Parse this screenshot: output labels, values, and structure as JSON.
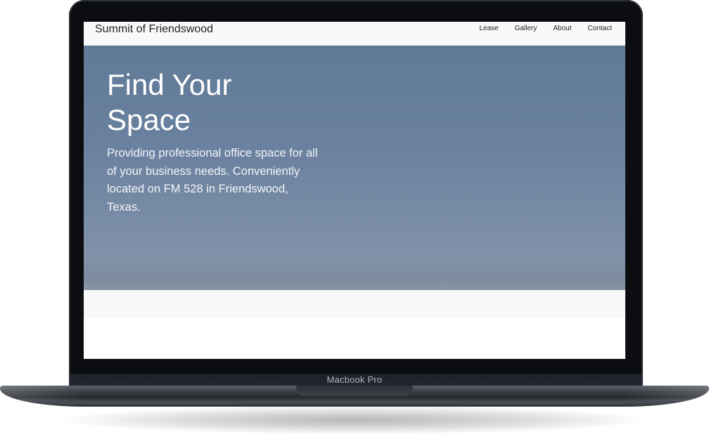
{
  "device": {
    "label": "Macbook Pro"
  },
  "site": {
    "brand": "Summit of Friendswood",
    "nav": [
      {
        "label": "Lease"
      },
      {
        "label": "Gallery"
      },
      {
        "label": "About"
      },
      {
        "label": "Contact"
      }
    ]
  },
  "hero": {
    "title": "Find Your Space",
    "description": "Providing professional office space for all of your business needs. Conveniently located on FM 528 in Friendswood, Texas."
  },
  "colors": {
    "hero_sky": "#6b82a0",
    "nav_bg": "#f9f9f9",
    "bezel": "#0b0d10"
  }
}
